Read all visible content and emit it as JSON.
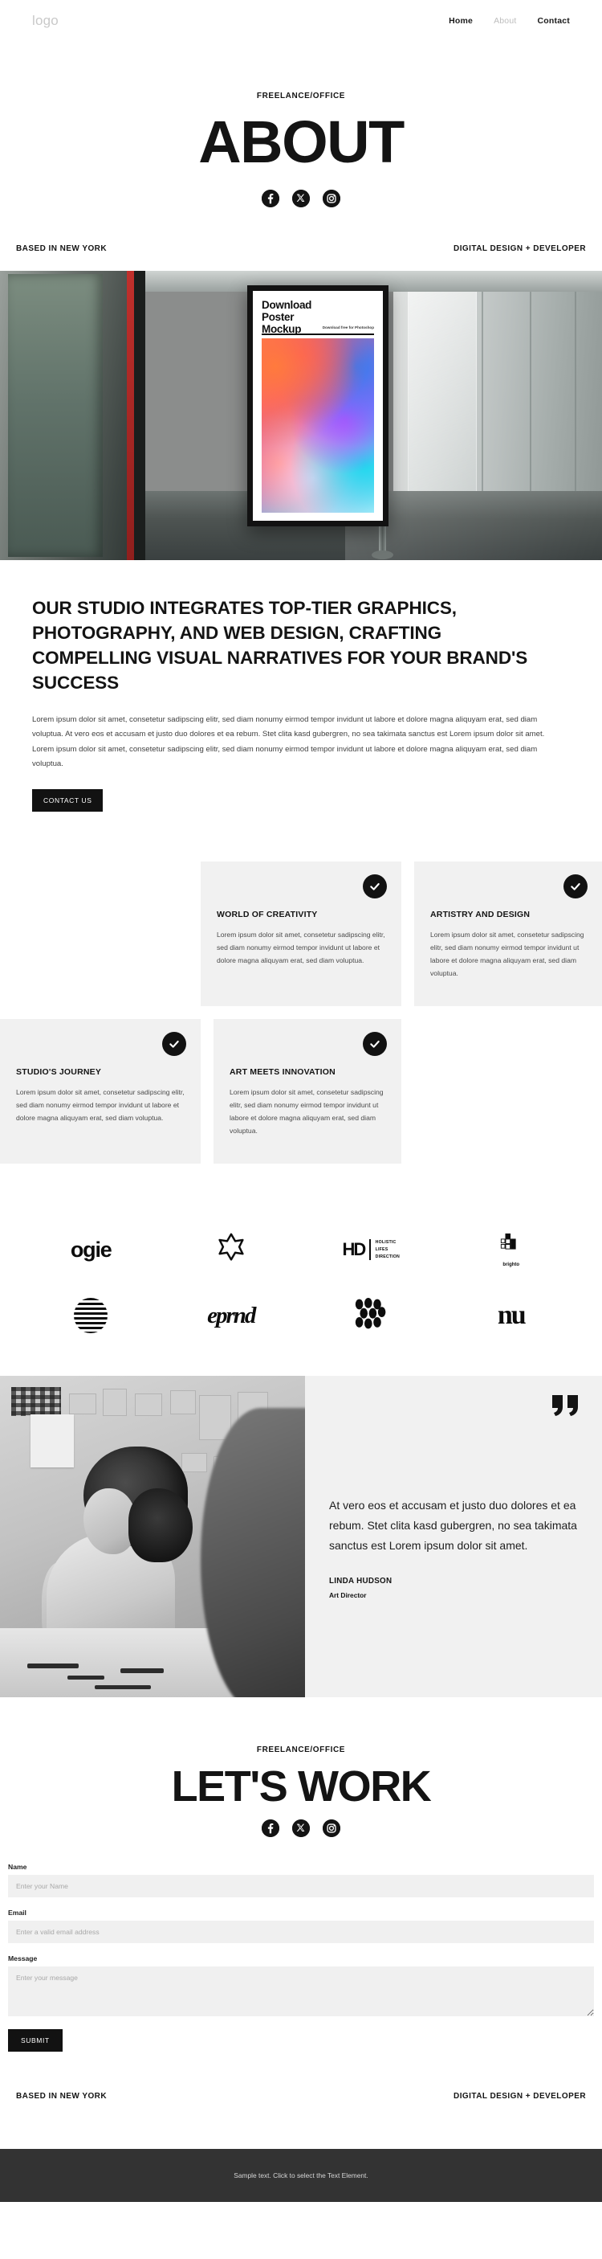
{
  "header": {
    "logo": "logo",
    "nav": [
      {
        "label": "Home",
        "active": false
      },
      {
        "label": "About",
        "active": true
      },
      {
        "label": "Contact",
        "active": false
      }
    ]
  },
  "hero": {
    "eyebrow": "FREELANCE/OFFICE",
    "title": "ABOUT",
    "socials": [
      "facebook-icon",
      "x-twitter-icon",
      "instagram-icon"
    ]
  },
  "metabar": {
    "left": "BASED IN NEW YORK",
    "right": "DIGITAL DESIGN + DEVELOPER"
  },
  "banner": {
    "poster_title": "Download\nPoster\nMockup",
    "poster_line1": "Download",
    "poster_line2": "Poster",
    "poster_line3": "Mockup",
    "poster_sub": "Download free\nfor Photoshop"
  },
  "studio": {
    "heading": "OUR STUDIO INTEGRATES TOP-TIER GRAPHICS, PHOTOGRAPHY, AND WEB DESIGN, CRAFTING COMPELLING VISUAL NARRATIVES FOR YOUR BRAND'S SUCCESS",
    "body": "Lorem ipsum dolor sit amet, consetetur sadipscing elitr, sed diam nonumy eirmod tempor invidunt ut labore et dolore magna aliquyam erat, sed diam voluptua. At vero eos et accusam et justo duo dolores et ea rebum. Stet clita kasd gubergren, no sea takimata sanctus est Lorem ipsum dolor sit amet. Lorem ipsum dolor sit amet, consetetur sadipscing elitr, sed diam nonumy eirmod tempor invidunt ut labore et dolore magna aliquyam erat, sed diam voluptua.",
    "cta": "CONTACT US"
  },
  "cards": [
    {
      "title": "WORLD OF CREATIVITY",
      "body": "Lorem ipsum dolor sit amet, consetetur sadipscing elitr, sed diam nonumy eirmod tempor invidunt ut labore et dolore magna aliquyam erat, sed diam voluptua.",
      "icon": "check-circle-icon"
    },
    {
      "title": "ARTISTRY AND DESIGN",
      "body": "Lorem ipsum dolor sit amet, consetetur sadipscing elitr, sed diam nonumy eirmod tempor invidunt ut labore et dolore magna aliquyam erat, sed diam voluptua.",
      "icon": "check-circle-icon"
    },
    {
      "title": "STUDIO'S JOURNEY",
      "body": "Lorem ipsum dolor sit amet, consetetur sadipscing elitr, sed diam nonumy eirmod tempor invidunt ut labore et dolore magna aliquyam erat, sed diam voluptua.",
      "icon": "check-circle-icon"
    },
    {
      "title": "ART MEETS INNOVATION",
      "body": "Lorem ipsum dolor sit amet, consetetur sadipscing elitr, sed diam nonumy eirmod tempor invidunt ut labore et dolore magna aliquyam erat, sed diam voluptua.",
      "icon": "check-circle-icon"
    }
  ],
  "logos": [
    {
      "name": "ogie",
      "text": "ogie"
    },
    {
      "name": "flower-mark",
      "text": ""
    },
    {
      "name": "hd-holistic-lifes-direction",
      "mark": "HD",
      "l1": "HOLISTIC",
      "l2": "LIFES",
      "l3": "DIRECTION"
    },
    {
      "name": "brighto",
      "text": "brighto"
    },
    {
      "name": "striped-oval-mark",
      "text": ""
    },
    {
      "name": "eprnd",
      "text": "eprnd"
    },
    {
      "name": "dots-mark",
      "text": ""
    },
    {
      "name": "nu",
      "text": "nu"
    }
  ],
  "testimonial": {
    "quote": "At vero eos et accusam et justo duo dolores et ea rebum. Stet clita kasd gubergren, no sea takimata sanctus est Lorem ipsum dolor sit amet.",
    "name": "LINDA HUDSON",
    "role": "Art Director",
    "quote_icon": "quotation-mark-icon",
    "photo_alt": "designer-working-photo"
  },
  "lets": {
    "eyebrow": "FREELANCE/OFFICE",
    "title": "LET'S WORK",
    "socials": [
      "facebook-icon",
      "x-twitter-icon",
      "instagram-icon"
    ]
  },
  "form": {
    "name_label": "Name",
    "name_placeholder": "Enter your Name",
    "name_value": "",
    "email_label": "Email",
    "email_placeholder": "Enter a valid email address",
    "email_value": "",
    "message_label": "Message",
    "message_placeholder": "Enter your message",
    "message_value": "",
    "submit": "SUBMIT"
  },
  "footer": {
    "left": "BASED IN NEW YORK",
    "right": "DIGITAL DESIGN + DEVELOPER",
    "bar": "Sample text. Click to select the Text Element."
  },
  "colors": {
    "ink": "#141414",
    "muted_nav": "#bdbdbd",
    "card_bg": "#f1f1f1",
    "field_bg": "#f0f0f0",
    "footer_bar": "#333333"
  }
}
